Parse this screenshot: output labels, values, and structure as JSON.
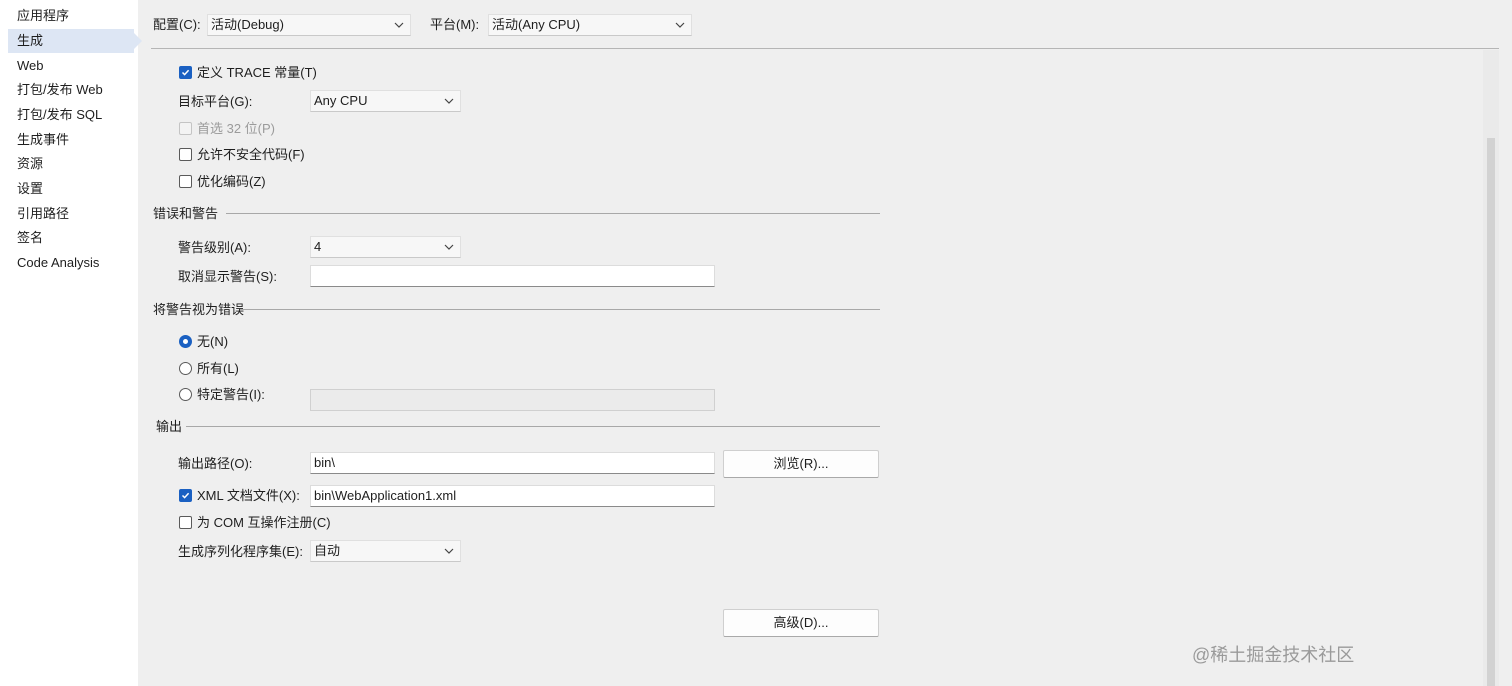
{
  "sidebar": {
    "items": [
      {
        "label": "应用程序"
      },
      {
        "label": "生成",
        "selected": true
      },
      {
        "label": "Web"
      },
      {
        "label": "打包/发布 Web"
      },
      {
        "label": "打包/发布 SQL"
      },
      {
        "label": "生成事件"
      },
      {
        "label": "资源"
      },
      {
        "label": "设置"
      },
      {
        "label": "引用路径"
      },
      {
        "label": "签名"
      },
      {
        "label": "Code Analysis"
      }
    ]
  },
  "toolbar": {
    "config_label": "配置(C):",
    "config_value": "活动(Debug)",
    "platform_label": "平台(M):",
    "platform_value": "活动(Any CPU)"
  },
  "general": {
    "define_trace": {
      "label": "定义 TRACE 常量(T)",
      "checked": true
    },
    "target_platform": {
      "label": "目标平台(G):",
      "value": "Any CPU"
    },
    "prefer32": {
      "label": "首选 32 位(P)",
      "checked": false,
      "disabled": true
    },
    "unsafe": {
      "label": "允许不安全代码(F)",
      "checked": false
    },
    "optimize": {
      "label": "优化编码(Z)",
      "checked": false
    }
  },
  "errors": {
    "section": "错误和警告",
    "warning_level": {
      "label": "警告级别(A):",
      "value": "4"
    },
    "suppress": {
      "label": "取消显示警告(S):",
      "value": ""
    }
  },
  "treat_warnings": {
    "section": "将警告视为错误",
    "none": {
      "label": "无(N)",
      "checked": true
    },
    "all": {
      "label": "所有(L)",
      "checked": false
    },
    "specific": {
      "label": "特定警告(I):",
      "checked": false,
      "value": ""
    }
  },
  "output": {
    "section": "输出",
    "path": {
      "label": "输出路径(O):",
      "value": "bin\\"
    },
    "browse_label": "浏览(R)...",
    "xml_doc": {
      "label": "XML 文档文件(X):",
      "checked": true,
      "value": "bin\\WebApplication1.xml"
    },
    "com": {
      "label": "为 COM 互操作注册(C)",
      "checked": false
    },
    "serialization": {
      "label": "生成序列化程序集(E):",
      "value": "自动"
    }
  },
  "advanced_label": "高级(D)...",
  "watermark": "@稀土掘金技术社区",
  "colors": {
    "accent": "#1a60c2",
    "background": "#efefef",
    "nav_selected": "#dde6f4"
  }
}
